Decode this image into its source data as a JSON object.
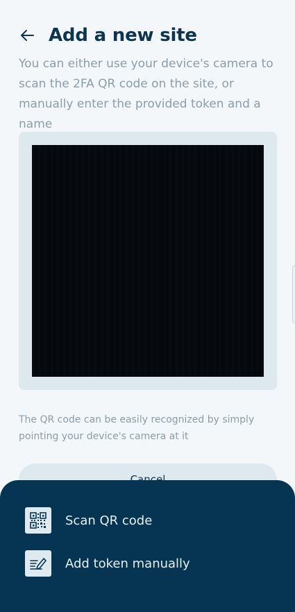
{
  "header": {
    "title": "Add a new site",
    "back_icon": "arrow-left-icon"
  },
  "description": "You can either use your device's camera to scan the 2FA QR code on the site, or manually enter the provided token and a name",
  "camera": {
    "state": "camera-preview"
  },
  "hint": "The QR code can be easily recognized by simply pointing your device's camera at it",
  "cancel_label": "Cancel",
  "sheet": {
    "items": [
      {
        "label": "Scan QR code",
        "icon": "qr-code-icon"
      },
      {
        "label": "Add token manually",
        "icon": "edit-note-icon"
      }
    ]
  },
  "colors": {
    "primary_dark": "#053552",
    "title": "#0d3550",
    "muted_text": "#8a9dab",
    "surface": "#dde8ef",
    "background": "#f4f7f9"
  }
}
